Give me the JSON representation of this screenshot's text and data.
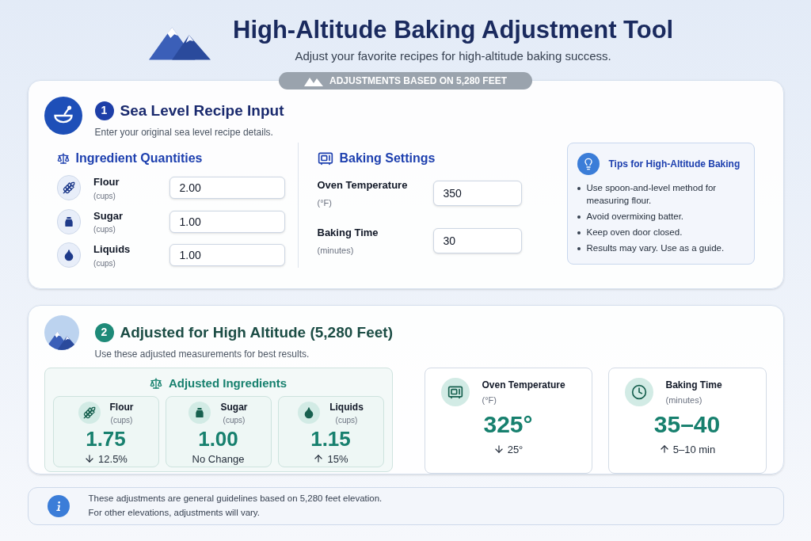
{
  "header": {
    "title": "High-Altitude Baking Adjustment Tool",
    "subtitle": "Adjust your favorite recipes for high-altitude baking success."
  },
  "badge": "ADJUSTMENTS BASED ON 5,280 FEET",
  "input_section": {
    "step": "1",
    "title": "Sea Level Recipe Input",
    "subtitle": "Enter your original sea level recipe details.",
    "ingredients": {
      "title": "Ingredient Quantities",
      "items": [
        {
          "kind": "flour",
          "name": "Flour",
          "unit": "(cups)",
          "value": "2.00"
        },
        {
          "kind": "sugar",
          "name": "Sugar",
          "unit": "(cups)",
          "value": "1.00"
        },
        {
          "kind": "liquid",
          "name": "Liquids",
          "unit": "(cups)",
          "value": "1.00"
        }
      ]
    },
    "baking": {
      "title": "Baking Settings",
      "items": [
        {
          "name": "Oven Temperature",
          "unit": "(°F)",
          "value": "350"
        },
        {
          "name": "Baking Time",
          "unit": "(minutes)",
          "value": "30"
        }
      ]
    },
    "tips": {
      "title": "Tips for High-Altitude Baking",
      "items": [
        "Use spoon-and-level method for measuring flour.",
        "Avoid overmixing batter.",
        "Keep oven door closed.",
        "Results may vary. Use as a guide."
      ]
    }
  },
  "adjusted_section": {
    "step": "2",
    "title": "Adjusted for High Altitude (5,280 Feet)",
    "subtitle": "Use these adjusted measurements for best results.",
    "ingredients": {
      "title": "Adjusted Ingredients",
      "items": [
        {
          "kind": "flour",
          "name": "Flour",
          "unit": "(cups)",
          "value": "1.75",
          "change": {
            "kind": "decrease",
            "text": "12.5%"
          }
        },
        {
          "kind": "sugar",
          "name": "Sugar",
          "unit": "(cups)",
          "value": "1.00",
          "change": {
            "kind": "unchanged",
            "text": "No Change"
          }
        },
        {
          "kind": "liquid",
          "name": "Liquids",
          "unit": "(cups)",
          "value": "1.15",
          "change": {
            "kind": "increase",
            "text": "15%"
          }
        }
      ]
    },
    "baking": [
      {
        "kind": "temperature",
        "name": "Oven Temperature",
        "unit": "(°F)",
        "value": "325°",
        "change": {
          "kind": "decrease",
          "text": "25°"
        }
      },
      {
        "kind": "time",
        "name": "Baking Time",
        "unit": "(minutes)",
        "value": "35–40",
        "change": {
          "kind": "increase",
          "text": "5–10 min"
        }
      }
    ]
  },
  "note": {
    "lines": [
      "These adjustments are general guidelines based on 5,280 feet elevation.",
      "For other elevations, adjustments will vary."
    ]
  }
}
